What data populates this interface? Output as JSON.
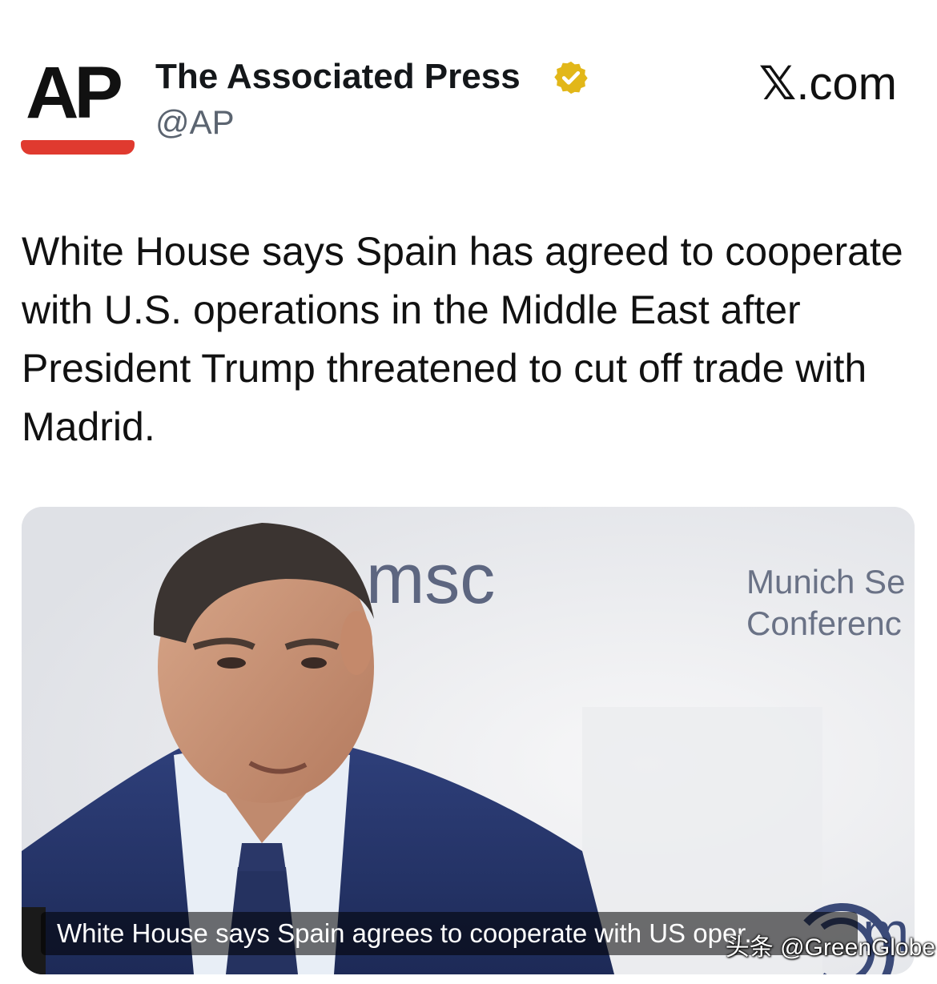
{
  "account": {
    "logo_text": "AP",
    "name": "The Associated Press",
    "handle": "@AP",
    "verified": true,
    "verified_badge_color": "#e2b719",
    "logo_bar_color": "#e03a2f"
  },
  "source": {
    "x_symbol": "𝕏",
    "label": ".com"
  },
  "post": {
    "text": "White House says Spain has agreed to cooperate with U.S. operations in the Middle East after President Trump threatened to cut off trade with Madrid."
  },
  "media": {
    "backdrop_text_1": "msc",
    "backdrop_text_2": "Munich Se",
    "backdrop_text_3": "Conferenc",
    "caption": "White House says Spain agrees to cooperate with US oper...",
    "watermark": "头条 @GreenGlobe"
  }
}
